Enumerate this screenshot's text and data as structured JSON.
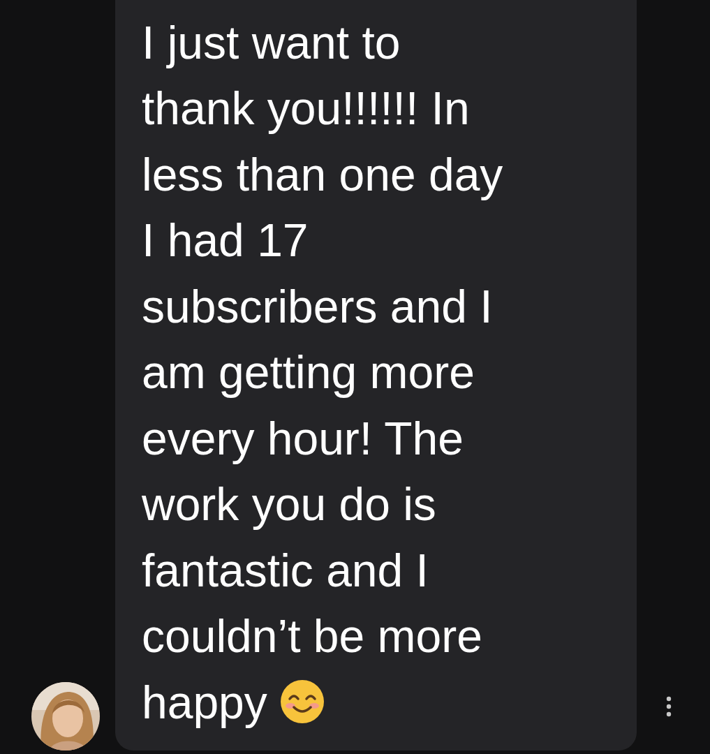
{
  "message": {
    "text": "I just want to\nthank you!!!!!! In\nless than one day\nI had 17\nsubscribers and I\nam getting more\nevery hour! The\nwork you do is\nfantastic and I\ncouldn’t be more\nhappy"
  }
}
